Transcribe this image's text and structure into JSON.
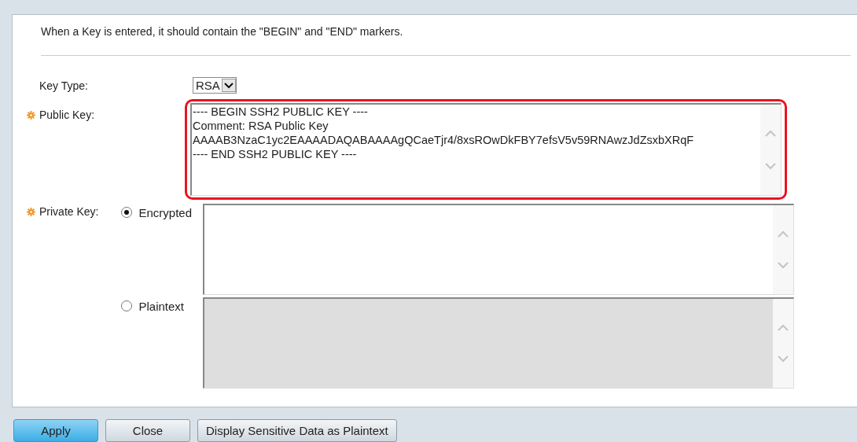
{
  "note": "When a Key is entered, it should contain the \"BEGIN\" and \"END\" markers.",
  "key_type": {
    "label": "Key Type:",
    "value": "RSA"
  },
  "public_key": {
    "label": "Public Key:",
    "required": true,
    "highlighted": true,
    "lines": [
      "---- BEGIN SSH2 PUBLIC KEY ----",
      "Comment: RSA Public Key",
      "AAAAB3NzaC1yc2EAAAADAQABAAAAgQCaeTjr4/8xsROwDkFBY7efsV5v59RNAwzJdZsxbXRqF",
      "---- END SSH2 PUBLIC KEY ----"
    ]
  },
  "private_key": {
    "label": "Private Key:",
    "required": true,
    "options": [
      {
        "label": "Encrypted",
        "selected": true
      },
      {
        "label": "Plaintext",
        "selected": false
      }
    ]
  },
  "buttons": [
    {
      "label": "Apply",
      "kind": "primary"
    },
    {
      "label": "Close",
      "kind": "normal"
    },
    {
      "label": "Display Sensitive Data as Plaintext",
      "kind": "normal"
    }
  ]
}
